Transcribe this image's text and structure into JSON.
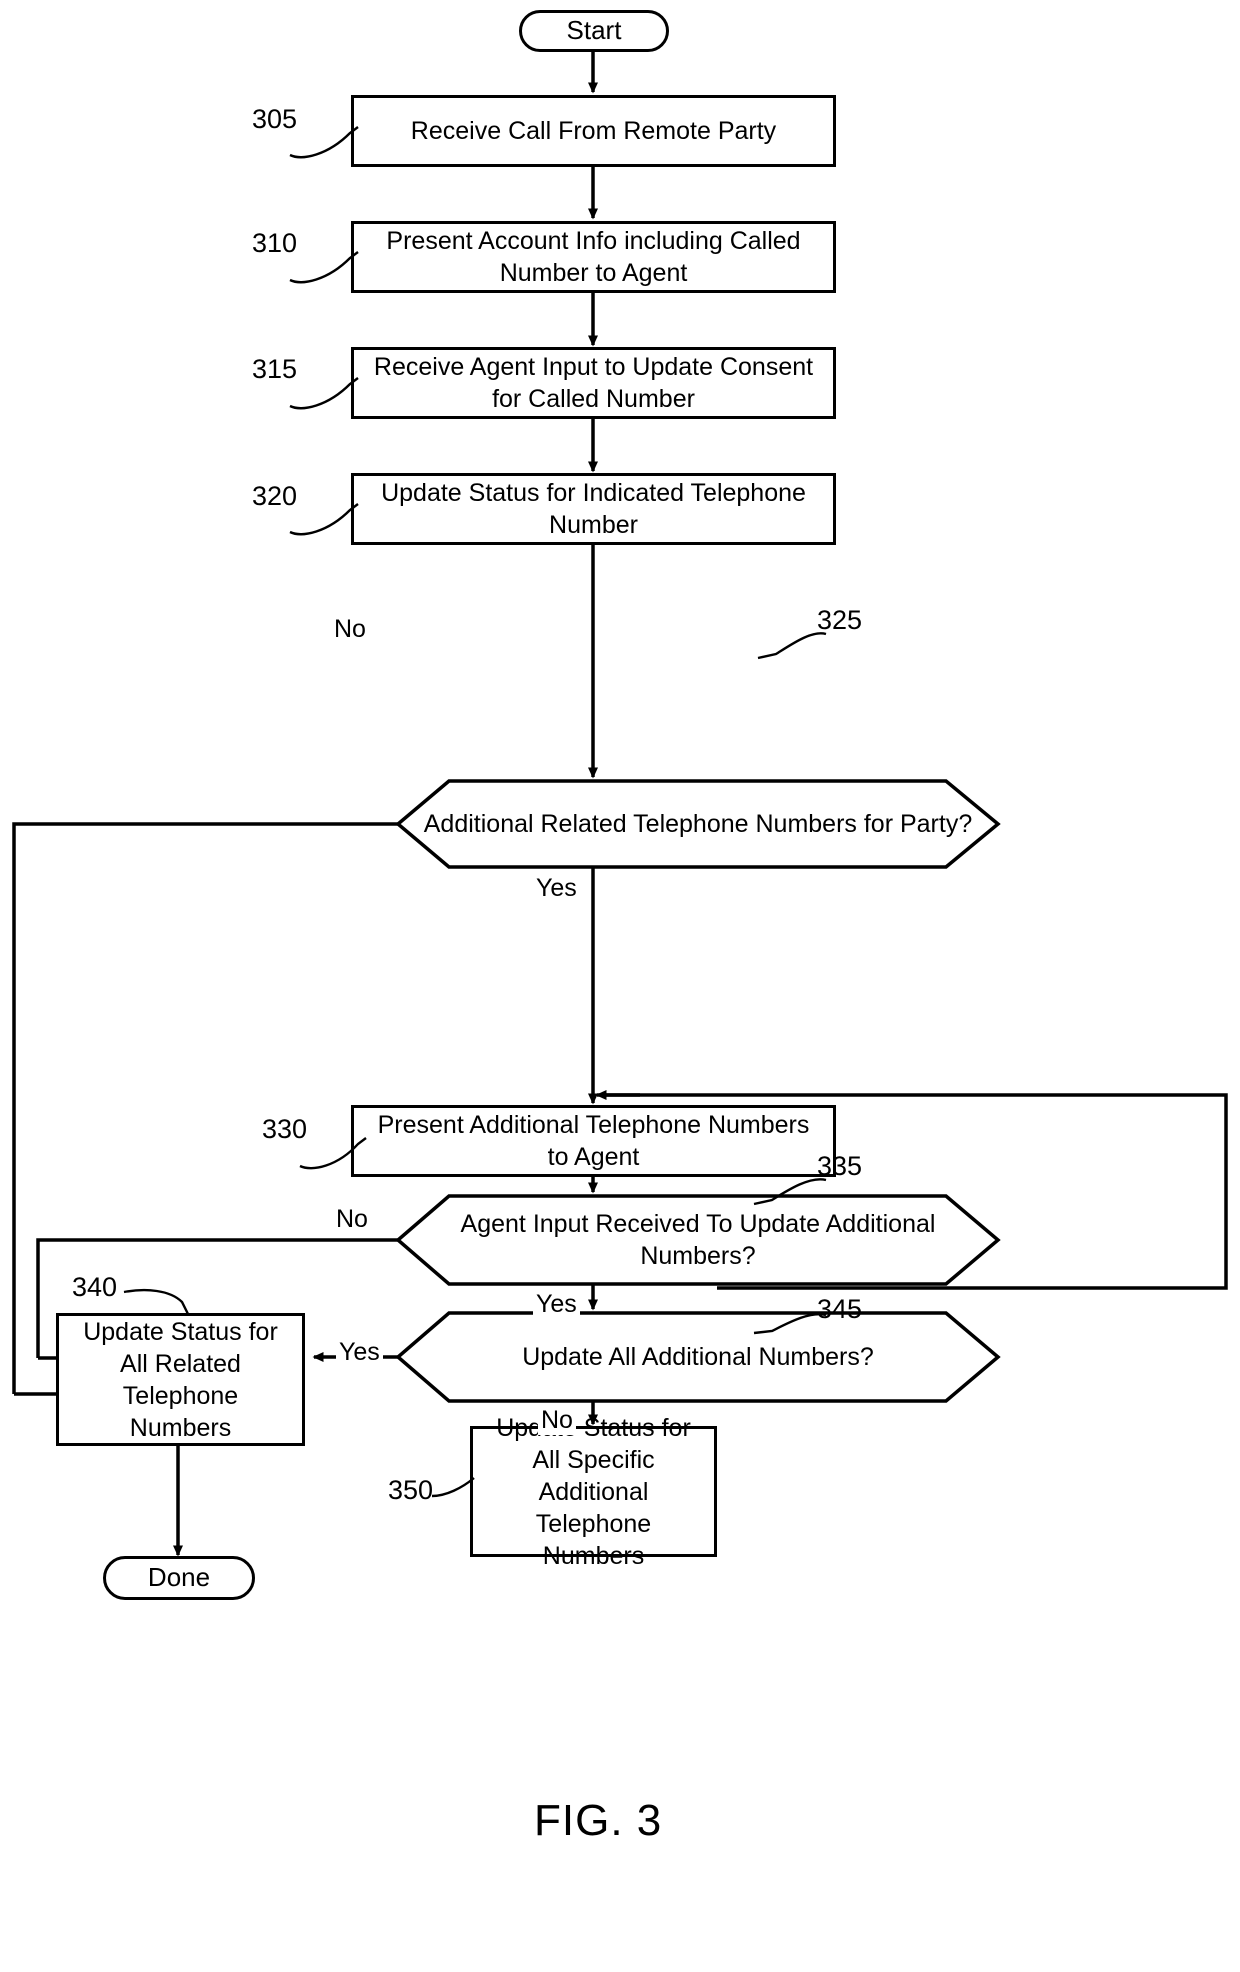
{
  "figure": {
    "caption": "FIG. 3"
  },
  "nodes": {
    "start": {
      "label": "Start",
      "ref": ""
    },
    "n305": {
      "label": "Receive Call From Remote Party",
      "ref": "305"
    },
    "n310": {
      "label": "Present Account Info including Called Number to Agent",
      "ref": "310"
    },
    "n315": {
      "label": "Receive Agent Input to Update Consent for Called Number",
      "ref": "315"
    },
    "n320": {
      "label": "Update Status for Indicated Telephone Number",
      "ref": "320"
    },
    "n325": {
      "label": "Additional Related Telephone Numbers for Party?",
      "ref": "325"
    },
    "n330": {
      "label": "Present Additional Telephone Numbers to Agent",
      "ref": "330"
    },
    "n335": {
      "label": "Agent Input Received To Update Additional Numbers?",
      "ref": "335"
    },
    "n340": {
      "label": "Update Status for All Related Telephone Numbers",
      "ref": "340"
    },
    "n345": {
      "label": "Update All Additional Numbers?",
      "ref": "345"
    },
    "n350": {
      "label": "Update Status for All Specific Additional Telephone Numbers",
      "ref": "350"
    },
    "done": {
      "label": "Done",
      "ref": ""
    }
  },
  "edge_labels": {
    "e325_no": "No",
    "e325_yes": "Yes",
    "e335_no": "No",
    "e335_yes": "Yes",
    "e345_yes": "Yes",
    "e345_no": "No"
  },
  "colors": {
    "stroke": "#000000",
    "background": "#ffffff"
  }
}
